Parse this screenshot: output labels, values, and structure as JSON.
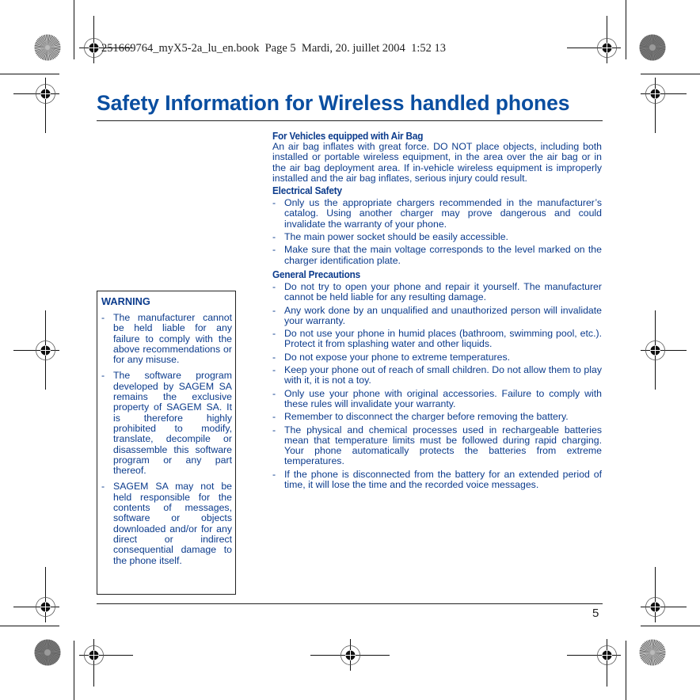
{
  "print_header": {
    "filename": "251669764_myX5-2a_lu_en.book",
    "page_label": "Page 5",
    "date": "Mardi, 20. juillet 2004",
    "time": "1:52 13"
  },
  "page": {
    "title": "Safety Information for Wireless handled phones",
    "page_number": "5"
  },
  "colors": {
    "title": "#0a4ea0",
    "body_text": "#0b3b8c",
    "rules": "#222222"
  },
  "sections": {
    "airbag": {
      "heading": "For Vehicles equipped with Air Bag",
      "body": "An air bag inflates with great force. DO NOT place objects, including both installed or portable wireless equipment, in the area over the air bag or in the air bag deployment area. If in-vehicle wireless equipment is improperly installed and the air bag inflates, serious injury could result."
    },
    "electrical": {
      "heading": "Electrical Safety",
      "items": [
        "Only us the appropriate chargers recommended in the manufacturer’s catalog. Using another charger may prove dangerous and could invalidate the warranty of your phone.",
        "The main power socket should be easily accessible.",
        "Make sure that the main voltage corresponds to the level marked on the charger identification plate."
      ]
    },
    "general": {
      "heading": "General Precautions",
      "items": [
        "Do not try to open your phone and repair it yourself. The manufacturer cannot be held liable for any resulting damage.",
        "Any work done by an unqualified and unauthorized person will invalidate your warranty.",
        "Do not use your phone in humid places (bathroom, swimming pool, etc.). Protect it from splashing water and other liquids.",
        "Do not expose your phone to extreme temperatures.",
        "Keep your phone out of reach of small children. Do not allow them to play with it, it is not a toy.",
        "Only use your phone with original accessories. Failure to comply with these rules will invalidate your warranty.",
        "Remember to disconnect the charger before removing the battery.",
        "The physical and chemical processes used in rechargeable batteries mean that temperature limits must be followed during rapid charging. Your phone automatically protects the batteries from extreme temperatures.",
        "If the phone is disconnected from the battery for an extended period of time, it will lose the time and the recorded voice messages."
      ]
    }
  },
  "warning": {
    "heading": "WARNING",
    "items": [
      "The manufacturer cannot be held liable for any failure to comply with the above recommendations or for any misuse.",
      "The software program developed by SAGEM SA remains the exclusive property of SAGEM SA. It is therefore highly prohibited to modify, translate, decompile or disassemble this software program or any part thereof.",
      "SAGEM SA may not be held responsible for the contents of messages, software or objects downloaded and/or for any direct or indirect consequential damage to the phone itself."
    ]
  },
  "print_marks": {
    "registration_mark_icon": "crosshair-circle",
    "color_bar_icon": "radial-starburst"
  }
}
